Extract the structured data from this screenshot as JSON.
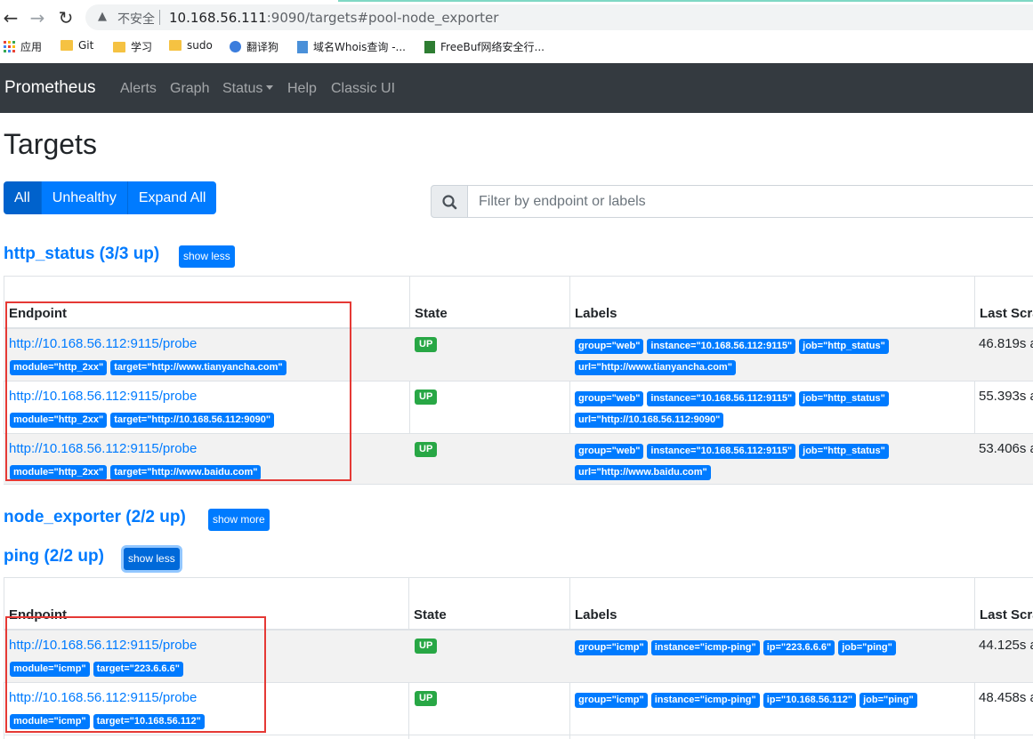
{
  "browser": {
    "insecure_label": "不安全",
    "url_host": "10.168.56.111",
    "url_rest": ":9090/targets#pool-node_exporter",
    "bookmarks": [
      "应用",
      "Git",
      "学习",
      "sudo",
      "翻译狗",
      "域名Whois查询 -...",
      "FreeBuf网络安全行..."
    ]
  },
  "navbar": {
    "brand": "Prometheus",
    "links": [
      "Alerts",
      "Graph",
      "Status",
      "Help",
      "Classic UI"
    ]
  },
  "page": {
    "title": "Targets",
    "filters": [
      "All",
      "Unhealthy",
      "Expand All"
    ],
    "search_placeholder": "Filter by endpoint or labels"
  },
  "columns": [
    "Endpoint",
    "State",
    "Labels",
    "Last Scra"
  ],
  "pools": [
    {
      "title": "http_status (3/3 up)",
      "toggle": "show less",
      "rows": [
        {
          "endpoint": "http://10.168.56.112:9115/probe",
          "params": [
            "module=\"http_2xx\"",
            "target=\"http://www.tianyancha.com\""
          ],
          "state": "UP",
          "labels_line1": [
            "group=\"web\"",
            "instance=\"10.168.56.112:9115\"",
            "job=\"http_status\""
          ],
          "labels_line2": [
            "url=\"http://www.tianyancha.com\""
          ],
          "last_scrape": "46.819s a"
        },
        {
          "endpoint": "http://10.168.56.112:9115/probe",
          "params": [
            "module=\"http_2xx\"",
            "target=\"http://10.168.56.112:9090\""
          ],
          "state": "UP",
          "labels_line1": [
            "group=\"web\"",
            "instance=\"10.168.56.112:9115\"",
            "job=\"http_status\""
          ],
          "labels_line2": [
            "url=\"http://10.168.56.112:9090\""
          ],
          "last_scrape": "55.393s a"
        },
        {
          "endpoint": "http://10.168.56.112:9115/probe",
          "params": [
            "module=\"http_2xx\"",
            "target=\"http://www.baidu.com\""
          ],
          "state": "UP",
          "labels_line1": [
            "group=\"web\"",
            "instance=\"10.168.56.112:9115\"",
            "job=\"http_status\""
          ],
          "labels_line2": [
            "url=\"http://www.baidu.com\""
          ],
          "last_scrape": "53.406s a"
        }
      ]
    },
    {
      "title": "node_exporter (2/2 up)",
      "toggle": "show more",
      "rows": []
    },
    {
      "title": "ping (2/2 up)",
      "toggle": "show less",
      "rows": [
        {
          "endpoint": "http://10.168.56.112:9115/probe",
          "params": [
            "module=\"icmp\"",
            "target=\"223.6.6.6\""
          ],
          "state": "UP",
          "labels_line1": [
            "group=\"icmp\"",
            "instance=\"icmp-ping\"",
            "ip=\"223.6.6.6\"",
            "job=\"ping\""
          ],
          "labels_line2": [],
          "last_scrape": "44.125s a"
        },
        {
          "endpoint": "http://10.168.56.112:9115/probe",
          "params": [
            "module=\"icmp\"",
            "target=\"10.168.56.112\""
          ],
          "state": "UP",
          "labels_line1": [
            "group=\"icmp\"",
            "instance=\"icmp-ping\"",
            "ip=\"10.168.56.112\"",
            "job=\"ping\""
          ],
          "labels_line2": [],
          "last_scrape": "48.458s a"
        }
      ]
    }
  ],
  "colors": {
    "primary": "#007bff",
    "success": "#28a745",
    "navbar": "#343a40",
    "annotation": "#e53935"
  }
}
